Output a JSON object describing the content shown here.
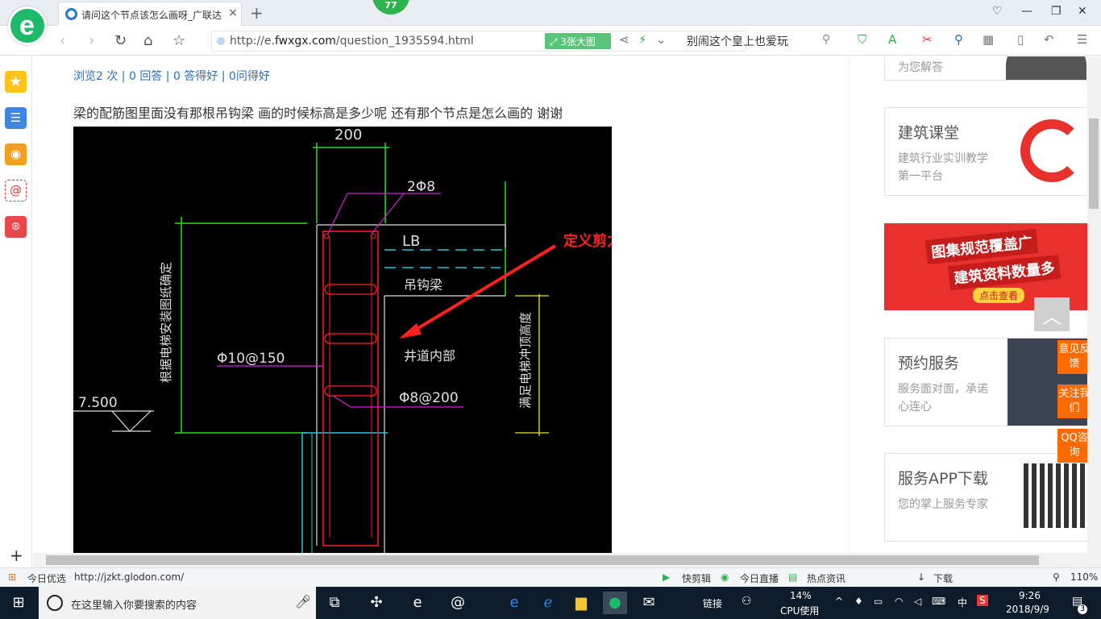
{
  "browser": {
    "tab_title": "请问这个节点该怎么画呀_广联达",
    "tab_close": "×",
    "new_tab": "+",
    "badge": "77",
    "url_prefix": "http://e.",
    "url_domain": "fwxgx.com",
    "url_path": "/question_1935594.html",
    "big_image_btn": "3张大图",
    "search_hint": "别闹这个皇上也爱玩"
  },
  "question": {
    "stats": "浏览2 次 | 0 回答 | 0 答得好 | 0问得好",
    "text": "梁的配筋图里面没有那根吊钩梁  画的时候标高是多少呢  还有那个节点是怎么画的 谢谢"
  },
  "cad": {
    "dim_top": "200",
    "bar_2phi8": "2Φ8",
    "lb": "LB",
    "hook_beam": "吊钩梁",
    "shaft_inside": "井道内部",
    "stirrup_10": "Φ10@150",
    "stirrup_8": "Φ8@200",
    "elev": "7.500",
    "vert_left": "根据电梯安装图纸确定",
    "vert_right": "满足电梯冲顶高度",
    "annot": "定义剪力墙"
  },
  "right": {
    "cards": [
      {
        "title": "",
        "desc": "为您解答"
      },
      {
        "title": "建筑课堂",
        "desc": "建筑行业实训教学第一平台"
      },
      {
        "title": "预约服务",
        "desc": "服务面对面，承诺心连心"
      },
      {
        "title": "服务APP下载",
        "desc": "您的掌上服务专家"
      }
    ],
    "banner_line1": "图集规范覆盖广",
    "banner_line2": "建筑资料数量多",
    "banner_btn": "点击查看",
    "float_feedback": "意见反馈",
    "float_follow": "关注我们",
    "float_qq": "QQ咨询"
  },
  "status": {
    "today": "今日优选",
    "link": "http://jzkt.glodon.com/",
    "kuaijian": "快剪辑",
    "live": "今日直播",
    "news": "热点资讯",
    "download": "下载",
    "zoom": "110%"
  },
  "taskbar": {
    "search_placeholder": "在这里输入你要搜索的内容",
    "link": "链接",
    "cpu_pct": "14%",
    "cpu_label": "CPU使用",
    "ime": "中",
    "time": "9:26",
    "date": "2018/9/9",
    "notif": "3"
  },
  "colors": {
    "accent": "#1fb96a",
    "link": "#2a6eb8",
    "orange": "#ff6a00",
    "cad_red": "#ff2020"
  }
}
